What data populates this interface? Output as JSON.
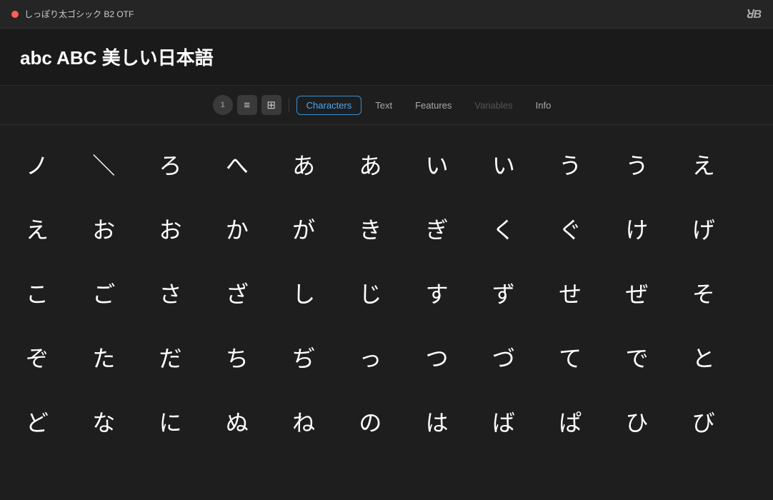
{
  "titlebar": {
    "dot_color": "#ff5f57",
    "title": "しっぽり太ゴシック B2 OTF",
    "icon_label": "ꓤB"
  },
  "preview": {
    "text": "abc ABC 美しい日本語"
  },
  "toolbar": {
    "btn1_label": "1",
    "btn2_label": "≡",
    "btn3_label": "≣",
    "tabs": [
      {
        "id": "characters",
        "label": "Characters",
        "active": true,
        "disabled": false
      },
      {
        "id": "text",
        "label": "Text",
        "active": false,
        "disabled": false
      },
      {
        "id": "features",
        "label": "Features",
        "active": false,
        "disabled": false
      },
      {
        "id": "variables",
        "label": "Variables",
        "active": false,
        "disabled": true
      },
      {
        "id": "info",
        "label": "Info",
        "active": false,
        "disabled": false
      }
    ]
  },
  "characters": {
    "cells": [
      "ノ",
      "＼",
      "ろ",
      "へ",
      "あ",
      "あ",
      "い",
      "い",
      "う",
      "う",
      "え",
      "え",
      "お",
      "お",
      "か",
      "が",
      "き",
      "ぎ",
      "く",
      "ぐ",
      "け",
      "げ",
      "こ",
      "ご",
      "さ",
      "ざ",
      "し",
      "じ",
      "す",
      "ず",
      "せ",
      "ぜ",
      "そ",
      "ぞ",
      "た",
      "だ",
      "ち",
      "ぢ",
      "っ",
      "つ",
      "づ",
      "て",
      "で",
      "と",
      "ど",
      "な",
      "に",
      "ぬ",
      "ね",
      "の",
      "は",
      "ば",
      "ぱ",
      "ひ",
      "び"
    ]
  }
}
